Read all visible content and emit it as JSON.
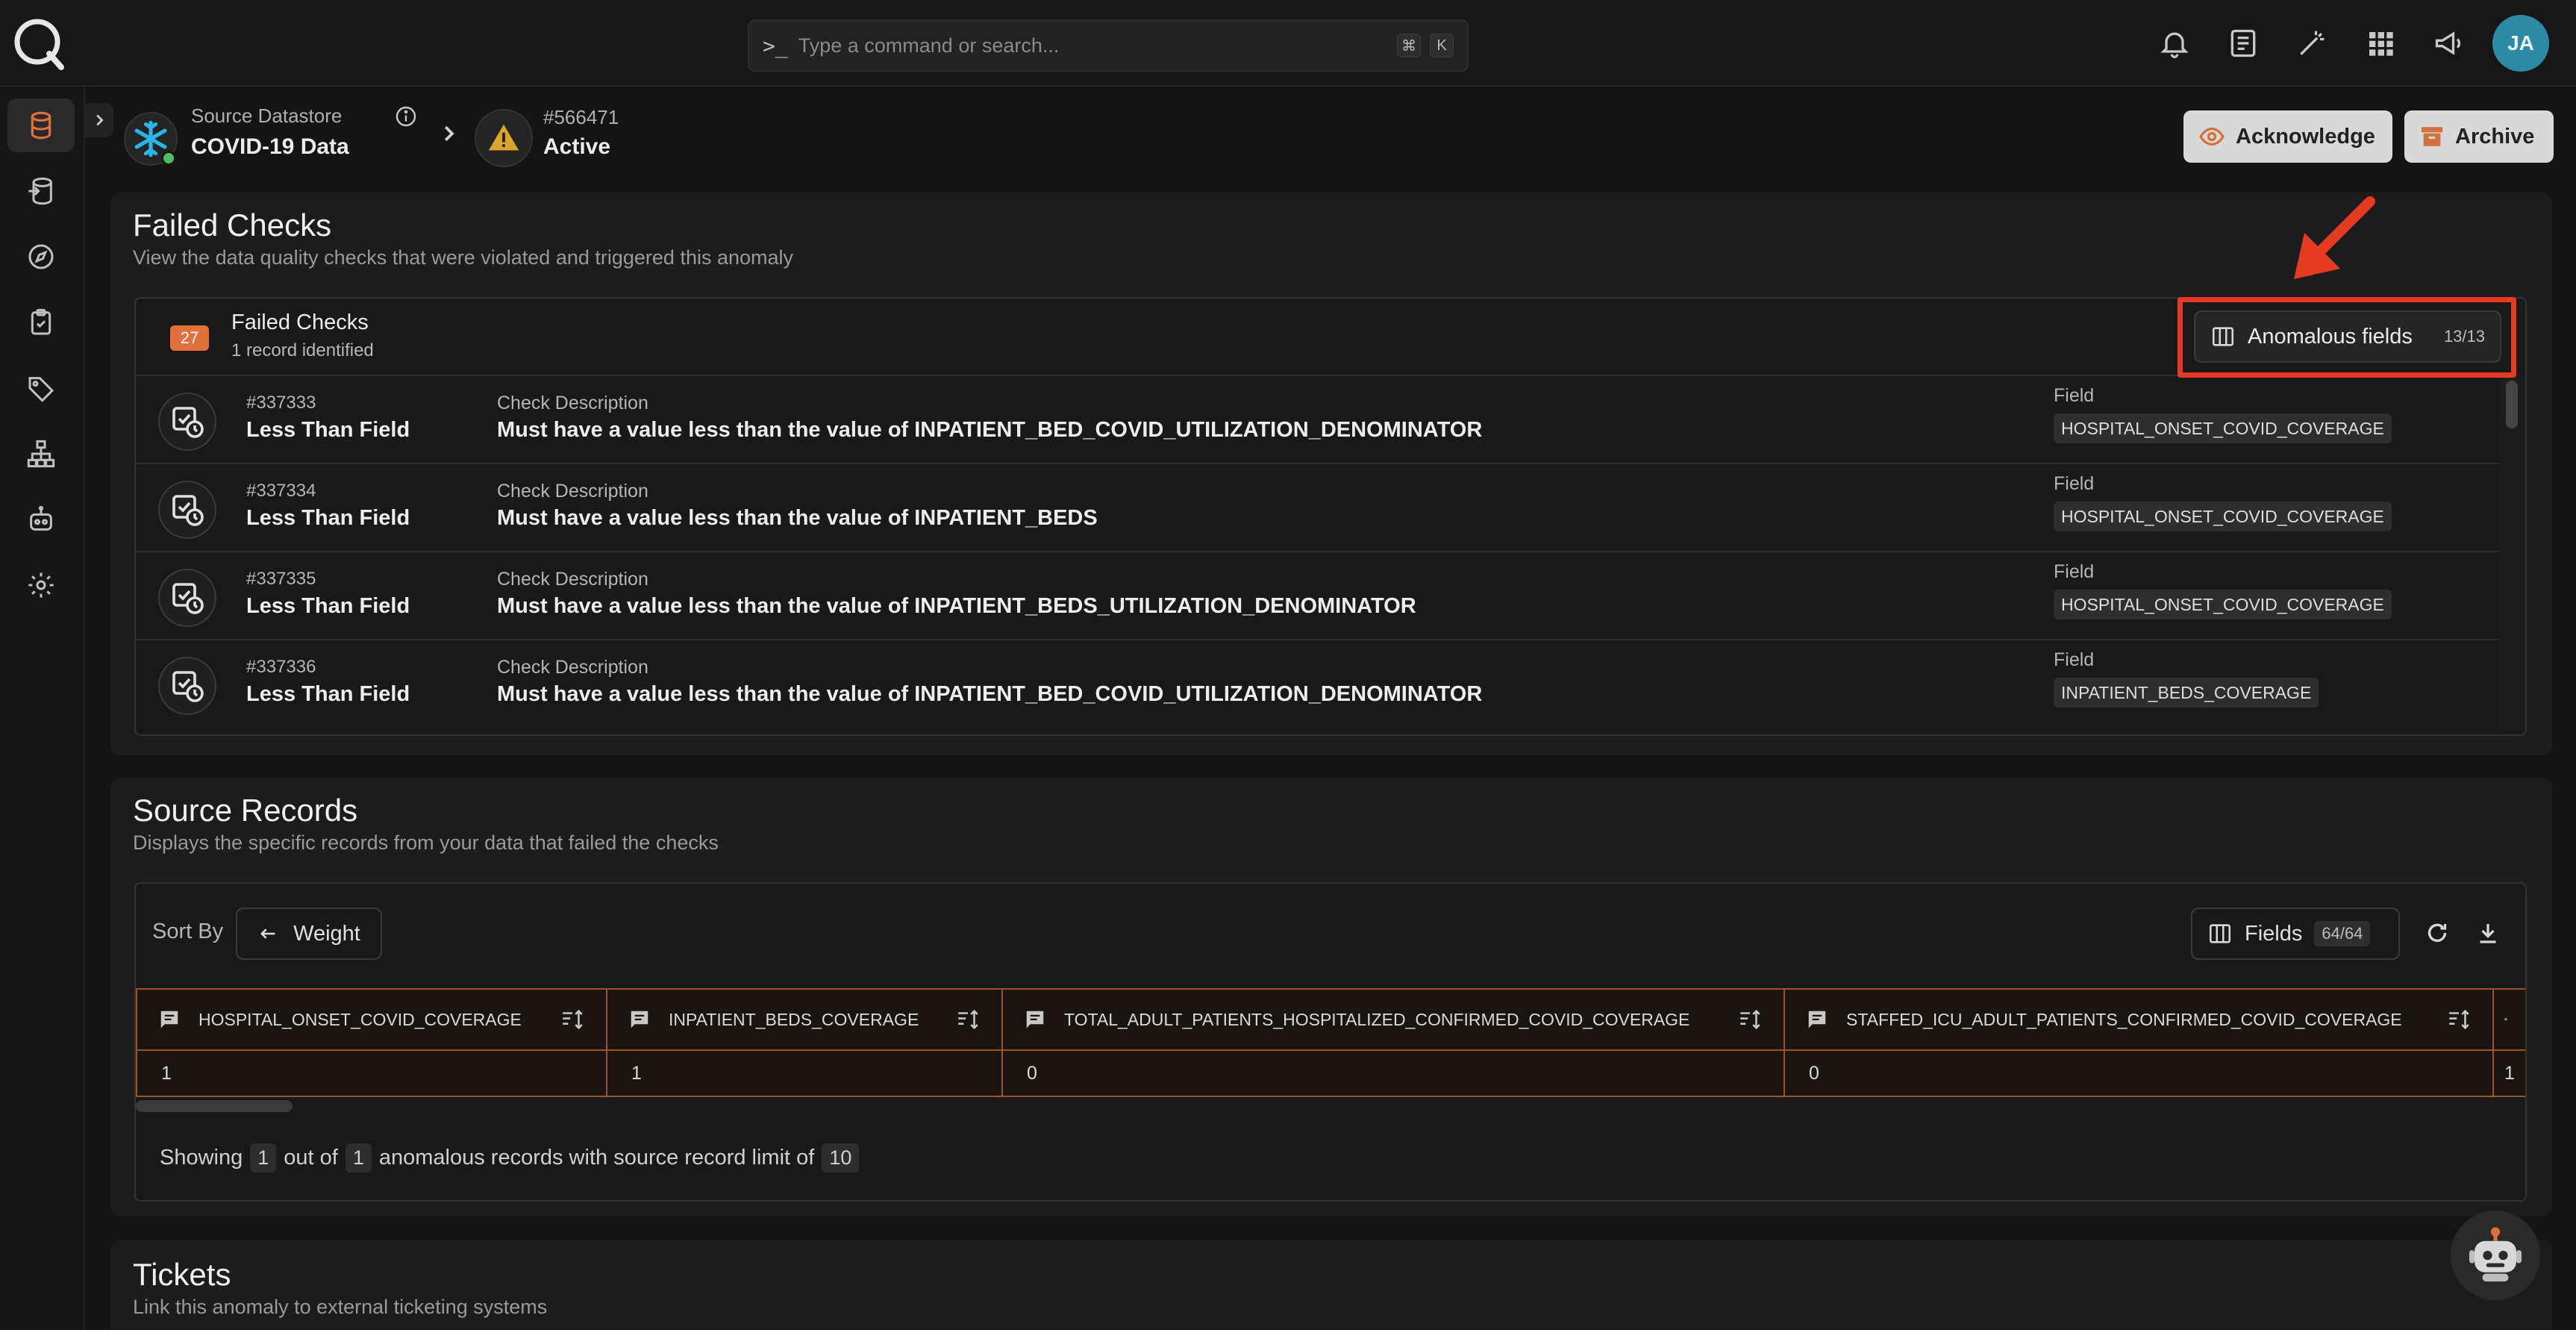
{
  "search": {
    "placeholder": "Type a command or search...",
    "shortcut_mod": "⌘",
    "shortcut_key": "K"
  },
  "user": {
    "initials": "JA"
  },
  "header": {
    "datastore_label": "Source Datastore",
    "datastore_name": "COVID-19 Data",
    "anomaly_id": "#566471",
    "anomaly_status": "Active",
    "acknowledge_label": "Acknowledge",
    "archive_label": "Archive"
  },
  "failed_checks": {
    "title": "Failed Checks",
    "description": "View the data quality checks that were violated and triggered this anomaly",
    "count": "27",
    "panel_title": "Failed Checks",
    "panel_sub": "1 record identified",
    "anomalous_fields_label": "Anomalous fields",
    "anomalous_fields_count": "13/13",
    "desc_label": "Check Description",
    "field_label": "Field",
    "rows": [
      {
        "id": "#337333",
        "type": "Less Than Field",
        "description": "Must have a value less than the value of INPATIENT_BED_COVID_UTILIZATION_DENOMINATOR",
        "field": "HOSPITAL_ONSET_COVID_COVERAGE"
      },
      {
        "id": "#337334",
        "type": "Less Than Field",
        "description": "Must have a value less than the value of INPATIENT_BEDS",
        "field": "HOSPITAL_ONSET_COVID_COVERAGE"
      },
      {
        "id": "#337335",
        "type": "Less Than Field",
        "description": "Must have a value less than the value of INPATIENT_BEDS_UTILIZATION_DENOMINATOR",
        "field": "HOSPITAL_ONSET_COVID_COVERAGE"
      },
      {
        "id": "#337336",
        "type": "Less Than Field",
        "description": "Must have a value less than the value of INPATIENT_BED_COVID_UTILIZATION_DENOMINATOR",
        "field": "INPATIENT_BEDS_COVERAGE"
      }
    ]
  },
  "source_records": {
    "title": "Source Records",
    "description": "Displays the specific records from your data that failed the checks",
    "sort_by_label": "Sort By",
    "sort_value": "Weight",
    "fields_label": "Fields",
    "fields_count": "64/64",
    "columns": [
      {
        "name": "HOSPITAL_ONSET_COVID_COVERAGE",
        "value": "1"
      },
      {
        "name": "INPATIENT_BEDS_COVERAGE",
        "value": "1"
      },
      {
        "name": "TOTAL_ADULT_PATIENTS_HOSPITALIZED_CONFIRMED_COVID_COVERAGE",
        "value": "0"
      },
      {
        "name": "STAFFED_ICU_ADULT_PATIENTS_CONFIRMED_COVID_COVERAGE",
        "value": "0"
      },
      {
        "name": "",
        "value": "1"
      }
    ],
    "showing_prefix": "Showing",
    "showing_count": "1",
    "showing_mid": "out of",
    "showing_total": "1",
    "showing_suffix": "anomalous records with source record limit of",
    "showing_limit": "10"
  },
  "tickets": {
    "title": "Tickets",
    "description": "Link this anomaly to external ticketing systems"
  },
  "colors": {
    "accent_orange": "#e2703a",
    "highlight_red": "#e63b22",
    "avatar_teal": "#2c8aa6",
    "status_green": "#4cbe63"
  }
}
